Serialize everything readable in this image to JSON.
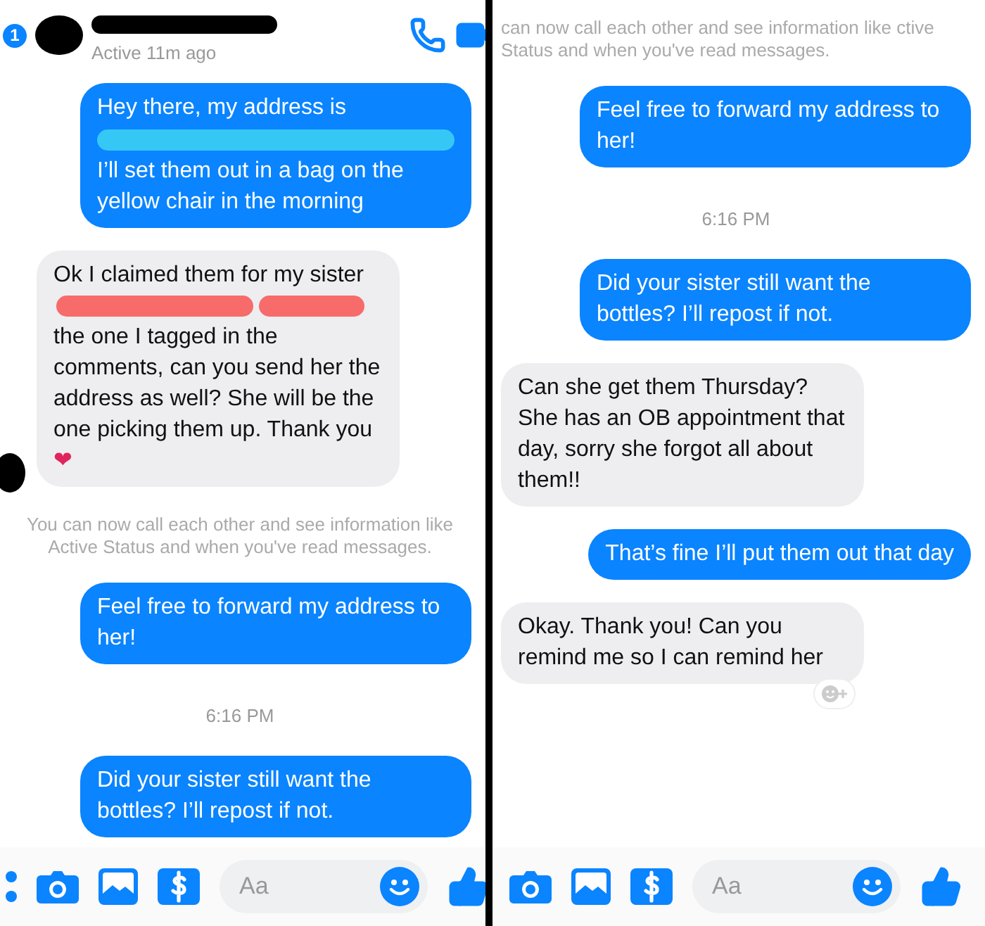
{
  "panels": [
    {
      "header": {
        "badge": "1",
        "status": "Active 11m ago"
      },
      "messages": [
        {
          "kind": "sent",
          "segments": [
            {
              "kind": "text",
              "text": "Hey there, my address is"
            },
            {
              "kind": "redaction",
              "color": "#35c8f5"
            },
            {
              "kind": "text",
              "text": "I’ll set them out in a bag on the yellow chair in the morning"
            }
          ]
        },
        {
          "kind": "received",
          "avatar": true,
          "segments": [
            {
              "kind": "text",
              "text": "Ok I claimed them for my sister"
            },
            {
              "kind": "redaction",
              "color": "#f76b6b"
            },
            {
              "kind": "redaction",
              "color": "#f76b6b"
            },
            {
              "kind": "text",
              "text": "the one I tagged in the comments, can you send her the address as well? She will be the one picking them up. Thank you"
            },
            {
              "kind": "emoji",
              "text": "❤"
            }
          ]
        },
        {
          "kind": "system",
          "text": "You can now call each other and see information like Active Status and when you've read messages."
        },
        {
          "kind": "sent",
          "segments": [
            {
              "kind": "text",
              "text": "Feel free to forward my address to her!"
            }
          ]
        },
        {
          "kind": "time",
          "text": "6:16 PM"
        },
        {
          "kind": "sent",
          "segments": [
            {
              "kind": "text",
              "text": "Did your sister still want the bottles? I’ll repost if not."
            }
          ]
        }
      ],
      "composer": {
        "more_button": true,
        "placeholder": "Aa"
      }
    },
    {
      "messages": [
        {
          "kind": "system",
          "text": "can now call each other and see information like ctive Status and when you've read messages."
        },
        {
          "kind": "sent",
          "segments": [
            {
              "kind": "text",
              "text": "Feel free to forward my address to her!"
            }
          ]
        },
        {
          "kind": "time",
          "text": "6:16 PM"
        },
        {
          "kind": "sent",
          "segments": [
            {
              "kind": "text",
              "text": "Did your sister still want the bottles? I’ll repost if not."
            }
          ]
        },
        {
          "kind": "received",
          "avatar": false,
          "segments": [
            {
              "kind": "text",
              "text": "Can she get them Thursday? She has an OB appointment that day, sorry she forgot all about them!!"
            }
          ]
        },
        {
          "kind": "sent",
          "segments": [
            {
              "kind": "text",
              "text": "That’s fine I’ll put them out that day"
            }
          ]
        },
        {
          "kind": "received",
          "avatar": false,
          "reaction_button": true,
          "segments": [
            {
              "kind": "text",
              "text": "Okay. Thank you! Can you remind me so I can remind her"
            }
          ]
        }
      ],
      "composer": {
        "more_button": false,
        "placeholder": "Aa"
      }
    }
  ]
}
